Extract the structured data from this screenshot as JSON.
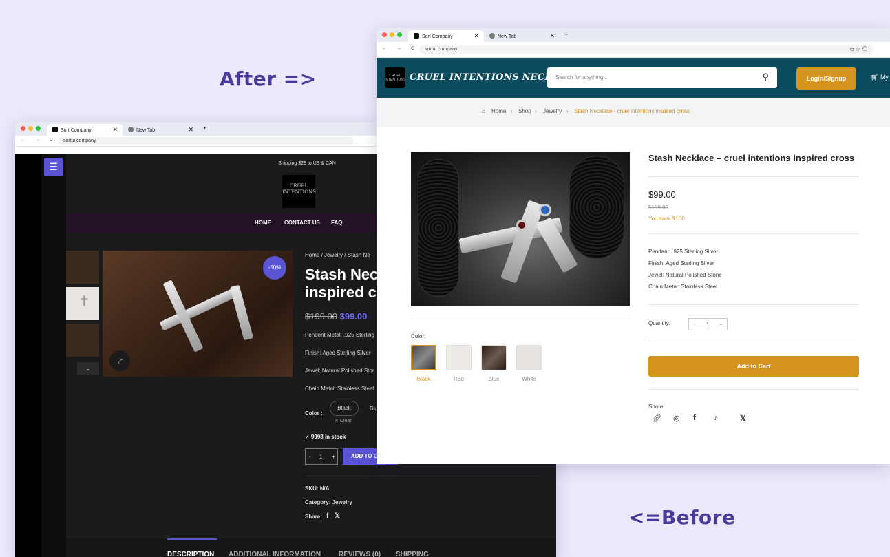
{
  "labels": {
    "after": "After =>",
    "before": "<=Before"
  },
  "browser": {
    "tab_active": "Sort Company",
    "tab_new": "New Tab",
    "tab_add": "+",
    "close": "✕",
    "url": "sortui.company",
    "nav": "← → C"
  },
  "before": {
    "shipping": "Shipping $29 to US & CAN",
    "logo_text": "CRUEL INTENTIONS",
    "nav": [
      "HOME",
      "CONTACT US",
      "FAQ"
    ],
    "badge": "-50%",
    "breadcrumb": "Home / Jewelry / Stash Ne",
    "title_line1": "Stash Nec",
    "title_line2": "inspired c",
    "old_price": "$199.00",
    "price": "$99.00",
    "specs": [
      "Pendent Metal: .925 Sterling",
      "Finish: Aged Sterling Silver",
      "Jewel: Natural Polished Stor",
      "Chain Metal: Stainless Steel"
    ],
    "color_label": "Color :",
    "color_selected": "Black",
    "color_next": "Blu",
    "clear": "✕ Clear",
    "stock": "✓ 9998 in stock",
    "qty": "1",
    "add_to_cart": "ADD TO C",
    "sku": "SKU: N/A",
    "category": "Category: Jewelry",
    "share": "Share:",
    "tabs": [
      "DESCRIPTION",
      "ADDITIONAL INFORMATION",
      "REVIEWS (0)",
      "SHIPPING"
    ]
  },
  "after": {
    "brand": "CRUEL INTENTIONS NECKLACES",
    "search_placeholder": "Search for anything...",
    "login": "Login/Signup",
    "my": "My",
    "breadcrumb": [
      "Home",
      "Shop",
      "Jewelry",
      "Stash Necklace - cruel intentions inspired cross"
    ],
    "title": "Stash Necklace – cruel intentions inspired cross",
    "price": "$99.00",
    "old_price": "$199.00",
    "save": "You save $100",
    "specs": [
      "Pendant: .925 Sterling Silver",
      "Finish: Aged Sterling Silver",
      "Jewel: Natural Polished Stone",
      "Chain Metal: Stainless Steel"
    ],
    "quantity_label": "Quantity:",
    "qty": "1",
    "add_to_cart": "Add to Cart",
    "share": "Share",
    "color_label": "Color:",
    "colors": [
      "Black",
      "Red",
      "Blue",
      "White"
    ]
  },
  "colors": {
    "accent_old": "#5b55d6",
    "accent_new": "#d4921e",
    "header_new": "#0c4a5d"
  }
}
